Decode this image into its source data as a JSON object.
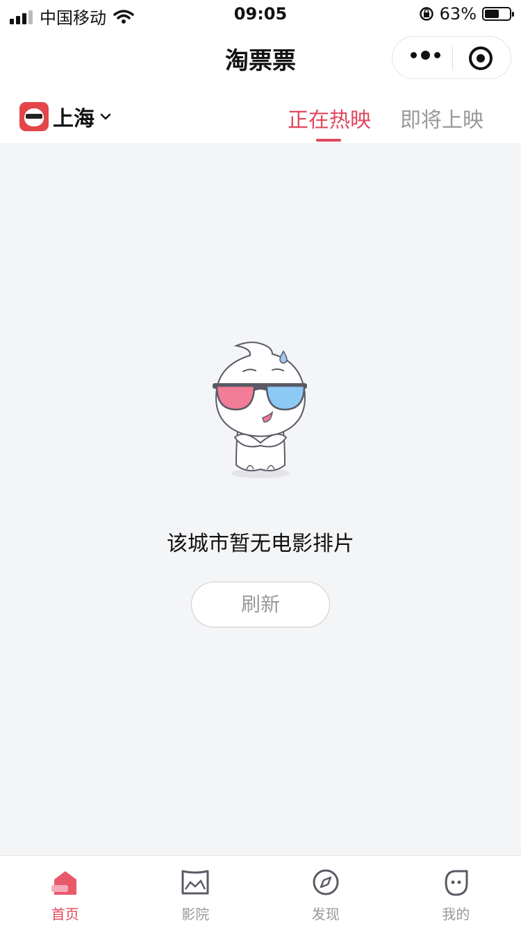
{
  "status_bar": {
    "carrier": "中国移动",
    "time": "09:05",
    "battery": "63%",
    "battery_level": 0.63
  },
  "nav": {
    "title": "淘票票"
  },
  "header": {
    "city": "上海",
    "tabs": [
      {
        "label": "正在热映",
        "active": true
      },
      {
        "label": "即将上映",
        "active": false
      }
    ]
  },
  "empty_state": {
    "message": "该城市暂无电影排片",
    "refresh_label": "刷新"
  },
  "tab_bar": {
    "items": [
      {
        "label": "首页",
        "icon": "home-icon",
        "active": true
      },
      {
        "label": "影院",
        "icon": "cinema-icon",
        "active": false
      },
      {
        "label": "发现",
        "icon": "compass-icon",
        "active": false
      },
      {
        "label": "我的",
        "icon": "profile-icon",
        "active": false
      }
    ]
  },
  "colors": {
    "accent": "#e0485c",
    "background": "#f4f5f7"
  }
}
